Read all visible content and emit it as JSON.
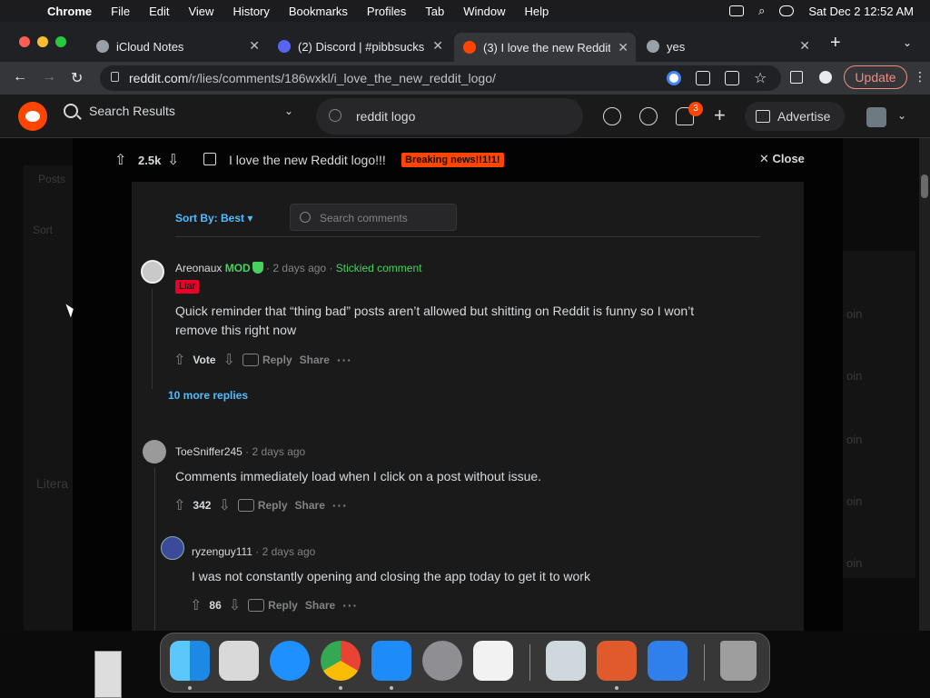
{
  "menubar": {
    "app": "Chrome",
    "items": [
      "File",
      "Edit",
      "View",
      "History",
      "Bookmarks",
      "Profiles",
      "Tab",
      "Window",
      "Help"
    ],
    "datetime": "Sat Dec 2  12:52 AM"
  },
  "tabs": [
    {
      "title": "iCloud Notes",
      "favicon_color": "#9aa0a6"
    },
    {
      "title": "(2) Discord | #pibbsucks",
      "favicon_color": "#5865f2"
    },
    {
      "title": "(3) I love the new Reddit",
      "favicon_color": "#ff4500"
    },
    {
      "title": "yes",
      "favicon_color": "#9aa0a6"
    }
  ],
  "toolbar": {
    "url_host": "reddit.com",
    "url_path": "/r/lies/comments/186wxkl/i_love_the_new_reddit_logo/",
    "update_label": "Update"
  },
  "header": {
    "results_label": "Search Results",
    "search_query": "reddit logo",
    "notif_count": "3",
    "advertise_label": "Advertise"
  },
  "post": {
    "votes": "2.5k",
    "title": "I love the new Reddit logo!!!",
    "flair": "Breaking news!!1!1!",
    "close_label": "Close"
  },
  "comments_ui": {
    "sort_label": "Sort By: Best",
    "search_placeholder": "Search comments",
    "more_replies": "10 more replies"
  },
  "comments": [
    {
      "user": "Areonaux",
      "mod": "MOD",
      "time": "2 days ago",
      "stickied": "Stickied comment",
      "flair": "Liar",
      "body": "Quick reminder that “thing bad” posts aren’t allowed but shitting on Reddit is funny so I won’t remove this right now",
      "score": "Vote",
      "reply": "Reply",
      "share": "Share"
    },
    {
      "user": "ToeSniffer245",
      "time": "2 days ago",
      "body": "Comments immediately load when I click on a post without issue.",
      "score": "342",
      "reply": "Reply",
      "share": "Share"
    },
    {
      "user": "ryzenguy111",
      "time": "2 days ago",
      "body": "I was not constantly opening and closing the app today to get it to work",
      "score": "86",
      "reply": "Reply",
      "share": "Share"
    }
  ],
  "background": {
    "left_labels": [
      "Posts",
      "Sort",
      "Litera"
    ],
    "right_labels": [
      "oin",
      "oin",
      "oin",
      "oin",
      "oin"
    ]
  },
  "colors": {
    "reddit_orange": "#ff4500",
    "link_blue": "#4fbcff",
    "mod_green": "#46d160",
    "liar_red": "#ea0027"
  }
}
